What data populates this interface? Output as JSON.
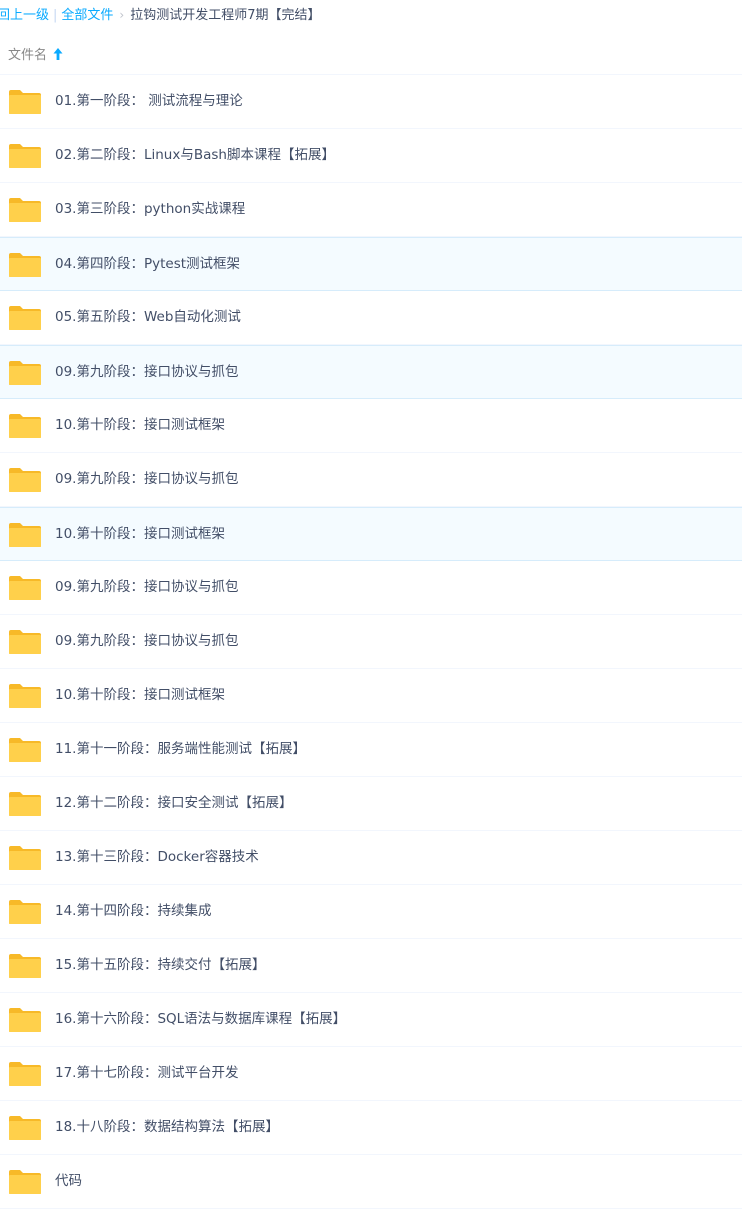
{
  "breadcrumb": {
    "back_label": "回上一级",
    "separator": "|",
    "all_files_label": "全部文件",
    "arrow": "›",
    "current_label": "拉钩测试开发工程师7期【完结】"
  },
  "header": {
    "column_label": "文件名",
    "sort_icon": "arrow-up-icon",
    "sort_direction": "ascending"
  },
  "colors": {
    "accent": "#09aaff",
    "folder": "#ffd04b",
    "folder_tab": "#f7b928",
    "text": "#424e67",
    "row_highlight": "#f4fbff"
  },
  "files": [
    {
      "name": "01.第一阶段： 测试流程与理论",
      "icon": "folder-icon"
    },
    {
      "name": "02.第二阶段：Linux与Bash脚本课程【拓展】",
      "icon": "folder-icon"
    },
    {
      "name": "03.第三阶段：python实战课程",
      "icon": "folder-icon"
    },
    {
      "name": "04.第四阶段：Pytest测试框架",
      "icon": "folder-icon"
    },
    {
      "name": "05.第五阶段：Web自动化测试",
      "icon": "folder-icon"
    },
    {
      "name": "09.第九阶段：接口协议与抓包",
      "icon": "folder-icon"
    },
    {
      "name": "10.第十阶段：接口测试框架",
      "icon": "folder-icon"
    },
    {
      "name": "09.第九阶段：接口协议与抓包",
      "icon": "folder-icon"
    },
    {
      "name": "10.第十阶段：接口测试框架",
      "icon": "folder-icon"
    },
    {
      "name": "09.第九阶段：接口协议与抓包",
      "icon": "folder-icon"
    },
    {
      "name": "09.第九阶段：接口协议与抓包",
      "icon": "folder-icon"
    },
    {
      "name": "10.第十阶段：接口测试框架",
      "icon": "folder-icon"
    },
    {
      "name": "11.第十一阶段：服务端性能测试【拓展】",
      "icon": "folder-icon"
    },
    {
      "name": "12.第十二阶段：接口安全测试【拓展】",
      "icon": "folder-icon"
    },
    {
      "name": "13.第十三阶段：Docker容器技术",
      "icon": "folder-icon"
    },
    {
      "name": "14.第十四阶段：持续集成",
      "icon": "folder-icon"
    },
    {
      "name": "15.第十五阶段：持续交付【拓展】",
      "icon": "folder-icon"
    },
    {
      "name": "16.第十六阶段：SQL语法与数据库课程【拓展】",
      "icon": "folder-icon"
    },
    {
      "name": "17.第十七阶段：测试平台开发",
      "icon": "folder-icon"
    },
    {
      "name": "18.十八阶段：数据结构算法【拓展】",
      "icon": "folder-icon"
    },
    {
      "name": "代码",
      "icon": "folder-icon"
    }
  ]
}
